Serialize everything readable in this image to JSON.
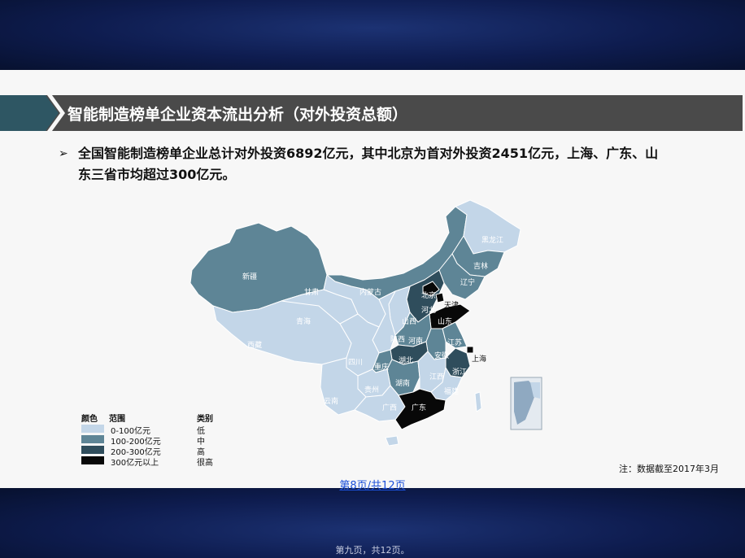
{
  "slide": {
    "title": "智能制造榜单企业资本流出分析（对外投资总额）",
    "bullet_line1": "全国智能制造榜单企业总计对外投资6892亿元，其中北京为首对外投资2451亿元，上海、广东、山",
    "bullet_line2": "东三省市均超过300亿元。",
    "note": "注：数据截至2017年3月",
    "page_number": "第8页/共12页",
    "footer": "第九页，共12页。"
  },
  "legend": {
    "header_color": "颜色",
    "header_range": "范围",
    "header_level": "类别",
    "items": [
      {
        "range": "0-100亿元",
        "level": "低",
        "color": "#c3d6e8"
      },
      {
        "range": "100-200亿元",
        "level": "中",
        "color": "#5e8596"
      },
      {
        "range": "200-300亿元",
        "level": "高",
        "color": "#2f4d5c"
      },
      {
        "range": "300亿元以上",
        "level": "很高",
        "color": "#080808"
      }
    ]
  },
  "provinces": {
    "xinjiang": "新疆",
    "xizang": "西藏",
    "qinghai": "青海",
    "gansu": "甘肃",
    "neimenggu": "内蒙古",
    "heilongjiang": "黑龙江",
    "jilin": "吉林",
    "liaoning": "辽宁",
    "beijing": "北京",
    "tianjin": "天津",
    "hebei": "河北",
    "shandong": "山东",
    "shanxi": "山西",
    "shaanxi": "陕西",
    "henan": "河南",
    "jiangsu": "江苏",
    "anhui": "安徽",
    "shanghai": "上海",
    "hubei": "湖北",
    "zhejiang": "浙江",
    "sichuan": "四川",
    "chongqing": "重庆",
    "hunan": "湖南",
    "jiangxi": "江西",
    "fujian": "福建",
    "guizhou": "贵州",
    "yunnan": "云南",
    "guangxi": "广西",
    "guangdong": "广东"
  }
}
